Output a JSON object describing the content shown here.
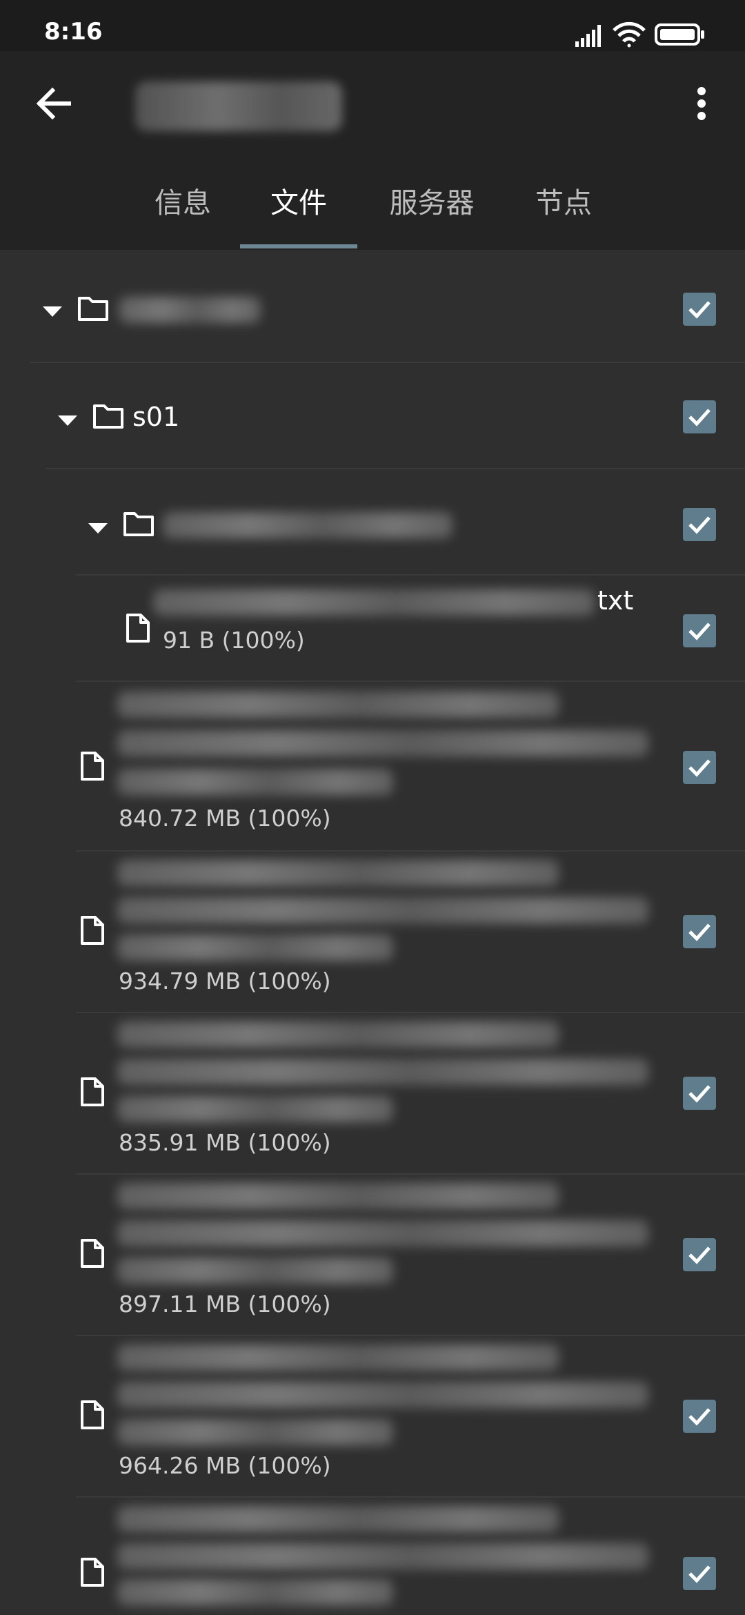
{
  "status_bar": {
    "time": "8:16",
    "signal_icon": "signal-icon",
    "wifi_icon": "wifi-icon",
    "battery_icon": "battery-icon"
  },
  "app_bar": {
    "back_icon": "arrow-back-icon",
    "more_icon": "more-vert-icon"
  },
  "tabs": [
    {
      "label": "信息",
      "active": false
    },
    {
      "label": "文件",
      "active": true
    },
    {
      "label": "服务器",
      "active": false
    },
    {
      "label": "节点",
      "active": false
    }
  ],
  "tree": {
    "root_folder": {
      "checked": true
    },
    "season_folder": {
      "name": "s01",
      "checked": true
    },
    "sub_folder": {
      "checked": true
    },
    "txt_file": {
      "name_suffix": "txt",
      "meta": "91 B (100%)",
      "checked": true
    },
    "video_files": [
      {
        "meta": "840.72 MB (100%)",
        "checked": true
      },
      {
        "meta": "934.79 MB (100%)",
        "checked": true
      },
      {
        "meta": "835.91 MB (100%)",
        "checked": true
      },
      {
        "meta": "897.11 MB (100%)",
        "checked": true
      },
      {
        "meta": "964.26 MB (100%)",
        "checked": true
      },
      {
        "meta": "",
        "checked": true
      }
    ]
  },
  "colors": {
    "accent": "#6d8795",
    "checkbox": "#5f7d8c",
    "background": "#2f2f2f",
    "appbar": "#232323"
  }
}
